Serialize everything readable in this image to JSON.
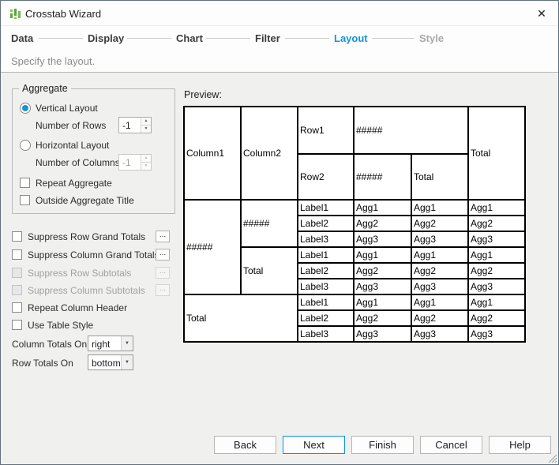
{
  "colors": {
    "accent_blue": "#1793d9",
    "icon_green": "#6cbf47",
    "table_border": "#000000"
  },
  "window": {
    "title": "Crosstab Wizard",
    "close_glyph": "✕"
  },
  "steps": {
    "active": "Layout",
    "items": [
      {
        "label": "Data"
      },
      {
        "label": "Display"
      },
      {
        "label": "Chart"
      },
      {
        "label": "Filter"
      },
      {
        "label": "Layout"
      },
      {
        "label": "Style"
      }
    ]
  },
  "subtitle": "Specify the layout.",
  "aggregate": {
    "legend": "Aggregate",
    "vertical": {
      "label": "Vertical Layout",
      "field_label": "Number of Rows",
      "value": "-1",
      "selected": true
    },
    "horizontal": {
      "label": "Horizontal Layout",
      "field_label": "Number of Columns",
      "value": "-1",
      "selected": false
    },
    "repeat_label": "Repeat Aggregate",
    "outside_label": "Outside Aggregate Title"
  },
  "icons": {
    "spinner_up": "▲",
    "spinner_down": "▼",
    "dropdown_arrow": "▼",
    "ellipsis": "..."
  },
  "options": [
    {
      "label": "Suppress Row Grand Totals",
      "enabled": true
    },
    {
      "label": "Suppress Column Grand Totals",
      "enabled": true
    },
    {
      "label": "Suppress Row Subtotals",
      "enabled": false
    },
    {
      "label": "Suppress Column Subtotals",
      "enabled": false
    },
    {
      "label": "Repeat Column Header",
      "enabled": true
    },
    {
      "label": "Use Table Style",
      "enabled": true
    }
  ],
  "totals": {
    "column": {
      "label": "Column Totals On",
      "value": "right"
    },
    "row": {
      "label": "Row Totals On",
      "value": "bottom"
    }
  },
  "preview": {
    "label": "Preview:",
    "header": {
      "col1": "Column1",
      "col2": "Column2",
      "row1": "Row1",
      "row2": "Row2",
      "hash_top": "#####",
      "hash_bottom": "#####",
      "total_sub": "Total",
      "total_grand": "Total"
    },
    "groups": {
      "row_group": "#####",
      "subgroup": "#####",
      "subgroup_total": "Total",
      "grand_total": "Total"
    },
    "rows": [
      {
        "label": "Label1",
        "v1": "Agg1",
        "v2": "Agg1",
        "v3": "Agg1"
      },
      {
        "label": "Label2",
        "v1": "Agg2",
        "v2": "Agg2",
        "v3": "Agg2"
      },
      {
        "label": "Label3",
        "v1": "Agg3",
        "v2": "Agg3",
        "v3": "Agg3"
      },
      {
        "label": "Label1",
        "v1": "Agg1",
        "v2": "Agg1",
        "v3": "Agg1"
      },
      {
        "label": "Label2",
        "v1": "Agg2",
        "v2": "Agg2",
        "v3": "Agg2"
      },
      {
        "label": "Label3",
        "v1": "Agg3",
        "v2": "Agg3",
        "v3": "Agg3"
      },
      {
        "label": "Label1",
        "v1": "Agg1",
        "v2": "Agg1",
        "v3": "Agg1"
      },
      {
        "label": "Label2",
        "v1": "Agg2",
        "v2": "Agg2",
        "v3": "Agg2"
      },
      {
        "label": "Label3",
        "v1": "Agg3",
        "v2": "Agg3",
        "v3": "Agg3"
      }
    ]
  },
  "footer": {
    "back": "Back",
    "next": "Next",
    "finish": "Finish",
    "cancel": "Cancel",
    "help": "Help"
  }
}
